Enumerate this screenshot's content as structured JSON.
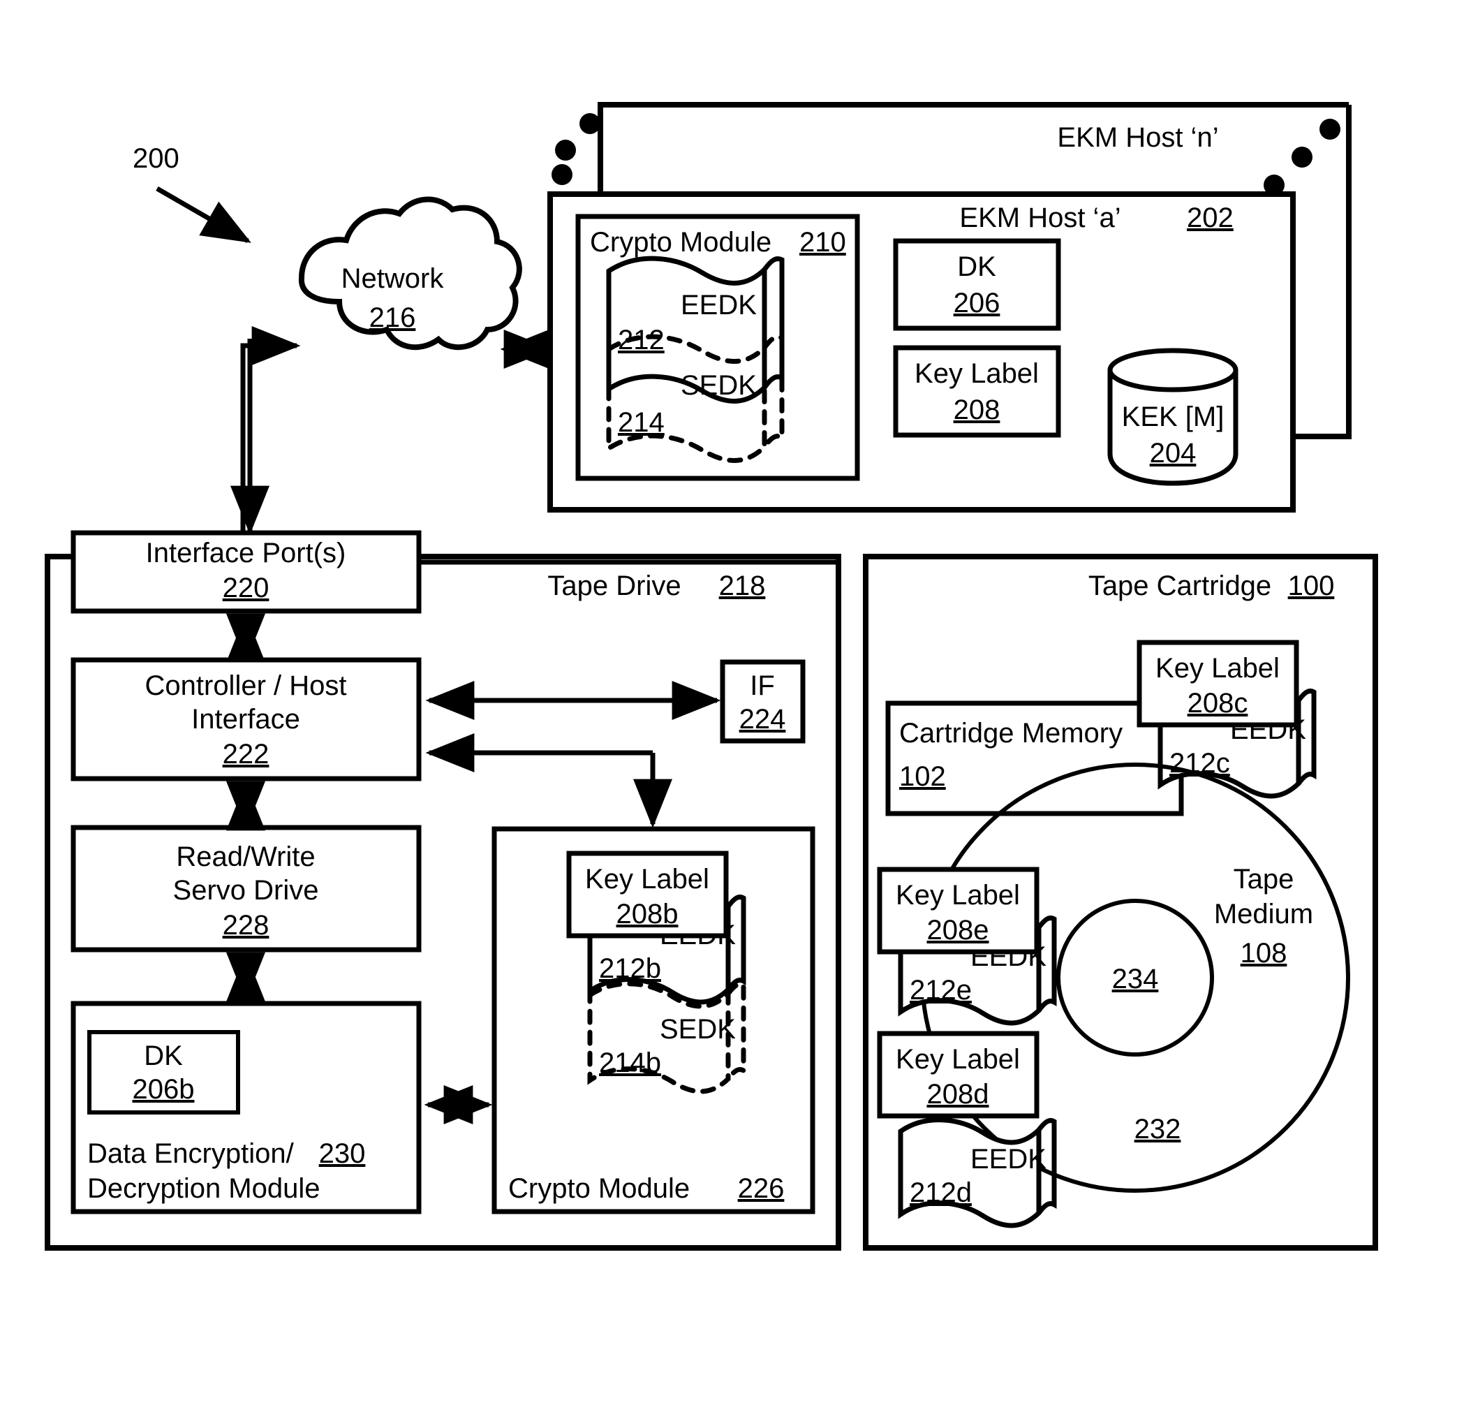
{
  "figure": {
    "ref_label": "200"
  },
  "network": {
    "name": "Network",
    "ref": "216"
  },
  "ekm_host_n": {
    "title": "EKM Host ‘n’"
  },
  "ekm_host_a": {
    "title": "EKM Host ‘a’",
    "ref": "202",
    "crypto_module": {
      "title": "Crypto Module",
      "ref": "210",
      "eedk": {
        "label": "EEDK",
        "ref": "212"
      },
      "sedk": {
        "label": "SEDK",
        "ref": "214"
      }
    },
    "dk": {
      "label": "DK",
      "ref": "206"
    },
    "key_label": {
      "label": "Key Label",
      "ref": "208"
    },
    "kek": {
      "label": "KEK [M]",
      "ref": "204"
    }
  },
  "tape_drive": {
    "title": "Tape Drive",
    "ref": "218",
    "interface_ports": {
      "line1": "Interface Port(s)",
      "ref": "220"
    },
    "controller": {
      "line1": "Controller / Host",
      "line2": "Interface",
      "ref": "222"
    },
    "iface": {
      "label": "IF",
      "ref": "224"
    },
    "servo": {
      "line1": "Read/Write",
      "line2": "Servo Drive",
      "ref": "228"
    },
    "dem": {
      "line1": "Data Encryption/",
      "line2": "Decryption Module",
      "ref": "230",
      "dk": {
        "label": "DK",
        "ref": "206b"
      }
    },
    "crypto_module": {
      "title": "Crypto Module",
      "ref": "226",
      "key_label": {
        "label": "Key Label",
        "ref": "208b"
      },
      "eedk": {
        "label": "EEDK",
        "ref": "212b"
      },
      "sedk": {
        "label": "SEDK",
        "ref": "214b"
      }
    }
  },
  "tape_cartridge": {
    "title": "Tape Cartridge",
    "ref": "100",
    "cartridge_memory": {
      "label": "Cartridge Memory",
      "ref": "102"
    },
    "cm_key_label": {
      "label": "Key Label",
      "ref": "208c"
    },
    "cm_eedk": {
      "label": "EEDK",
      "ref": "212c"
    },
    "tape_medium": {
      "line1": "Tape",
      "line2": "Medium",
      "ref": "108"
    },
    "hub_ref": "234",
    "medium_ref": "232",
    "key_label_e": {
      "label": "Key Label",
      "ref": "208e"
    },
    "eedk_e": {
      "label": "EEDK",
      "ref": "212e"
    },
    "key_label_d": {
      "label": "Key Label",
      "ref": "208d"
    },
    "eedk_d": {
      "label": "EEDK",
      "ref": "212d"
    }
  }
}
